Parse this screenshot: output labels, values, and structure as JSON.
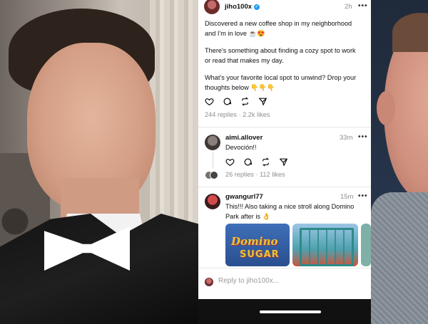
{
  "post": {
    "handle": "jiho100x",
    "time": "2h",
    "more": "•••",
    "paragraphs": [
      "Discovered a new coffee shop in my neighborhood and I'm in love ☕😍",
      "There's something about finding a cozy spot to work or read that makes my day.",
      "What's your favorite local spot to unwind? Drop your thoughts below 👇👇👇"
    ],
    "stats": "244 replies · 2.2k likes"
  },
  "replies": [
    {
      "handle": "aimi.allover",
      "time": "33m",
      "more": "•••",
      "text": "Devoción!!",
      "stats": "26 replies · 112 likes"
    },
    {
      "handle": "gwangurl77",
      "time": "15m",
      "more": "•••",
      "text": "This!!! Also taking a nice stroll along Domino Park after is 👌",
      "media_text": [
        "Domino",
        "SUGAR"
      ]
    }
  ],
  "reply_bar": {
    "placeholder": "Reply to jiho100x..."
  },
  "icons": [
    "heart-icon",
    "comment-icon",
    "repost-icon",
    "share-icon",
    "verified-badge-icon"
  ],
  "colors": {
    "verified": "#1d9bf0",
    "muted_text": "#8e8e8e"
  }
}
